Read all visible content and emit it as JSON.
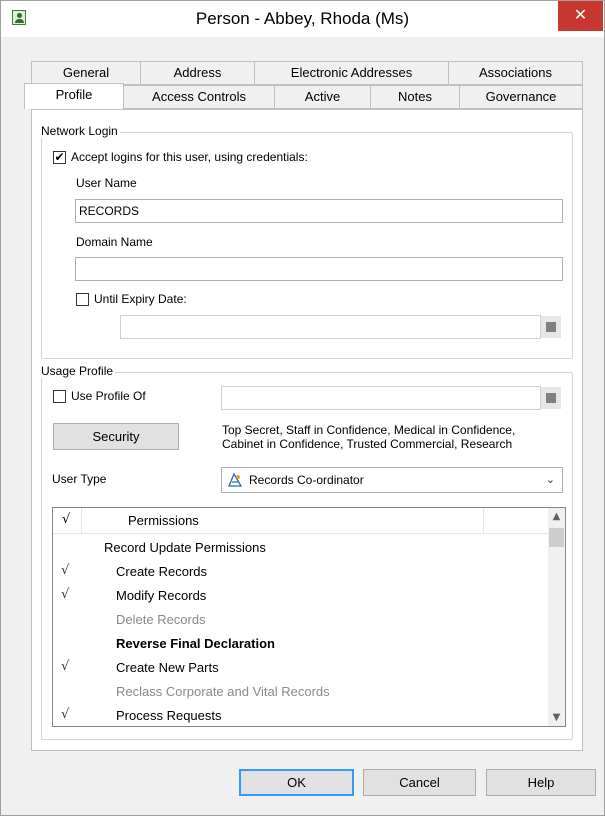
{
  "window": {
    "title": "Person - Abbey, Rhoda (Ms)",
    "close_glyph": "✕"
  },
  "tabs": {
    "row_back": [
      "General",
      "Address",
      "Electronic Addresses",
      "Associations"
    ],
    "row_front": [
      "Profile",
      "Access Controls",
      "Active",
      "Notes",
      "Governance"
    ],
    "active": "Profile"
  },
  "network_login": {
    "legend": "Network Login",
    "accept_logins_label": "Accept logins for this user, using credentials:",
    "accept_logins_checked": true,
    "user_name_label": "User Name",
    "user_name_value": "RECORDS",
    "domain_name_label": "Domain Name",
    "domain_name_value": "",
    "expiry_label": "Until Expiry Date:",
    "expiry_checked": false,
    "expiry_value": ""
  },
  "usage_profile": {
    "legend": "Usage Profile",
    "use_profile_label": "Use Profile Of",
    "use_profile_checked": false,
    "use_profile_value": "",
    "security_button": "Security",
    "security_text_line1": "Top Secret, Staff in Confidence, Medical in Confidence,",
    "security_text_line2": "Cabinet in Confidence, Trusted Commercial, Research",
    "user_type_label": "User Type",
    "user_type_value": "Records Co-ordinator",
    "user_type_icon": "records-coordinator-icon"
  },
  "permissions": {
    "header_check": "√",
    "header_title": "Permissions",
    "rows": [
      {
        "label": "Record Update Permissions",
        "check": "",
        "style": "group"
      },
      {
        "label": "Create Records",
        "check": "√",
        "style": "normal"
      },
      {
        "label": "Modify Records",
        "check": "√",
        "style": "normal"
      },
      {
        "label": "Delete Records",
        "check": "",
        "style": "disabled"
      },
      {
        "label": "Reverse Final Declaration",
        "check": "",
        "style": "bold"
      },
      {
        "label": "Create New Parts",
        "check": "√",
        "style": "normal"
      },
      {
        "label": "Reclass Corporate and Vital Records",
        "check": "",
        "style": "disabled"
      },
      {
        "label": "Process Requests",
        "check": "√",
        "style": "normal"
      }
    ]
  },
  "buttons": {
    "ok": "OK",
    "cancel": "Cancel",
    "help": "Help"
  },
  "colors": {
    "close_red": "#c7372f",
    "default_button_border": "#3399ff"
  }
}
